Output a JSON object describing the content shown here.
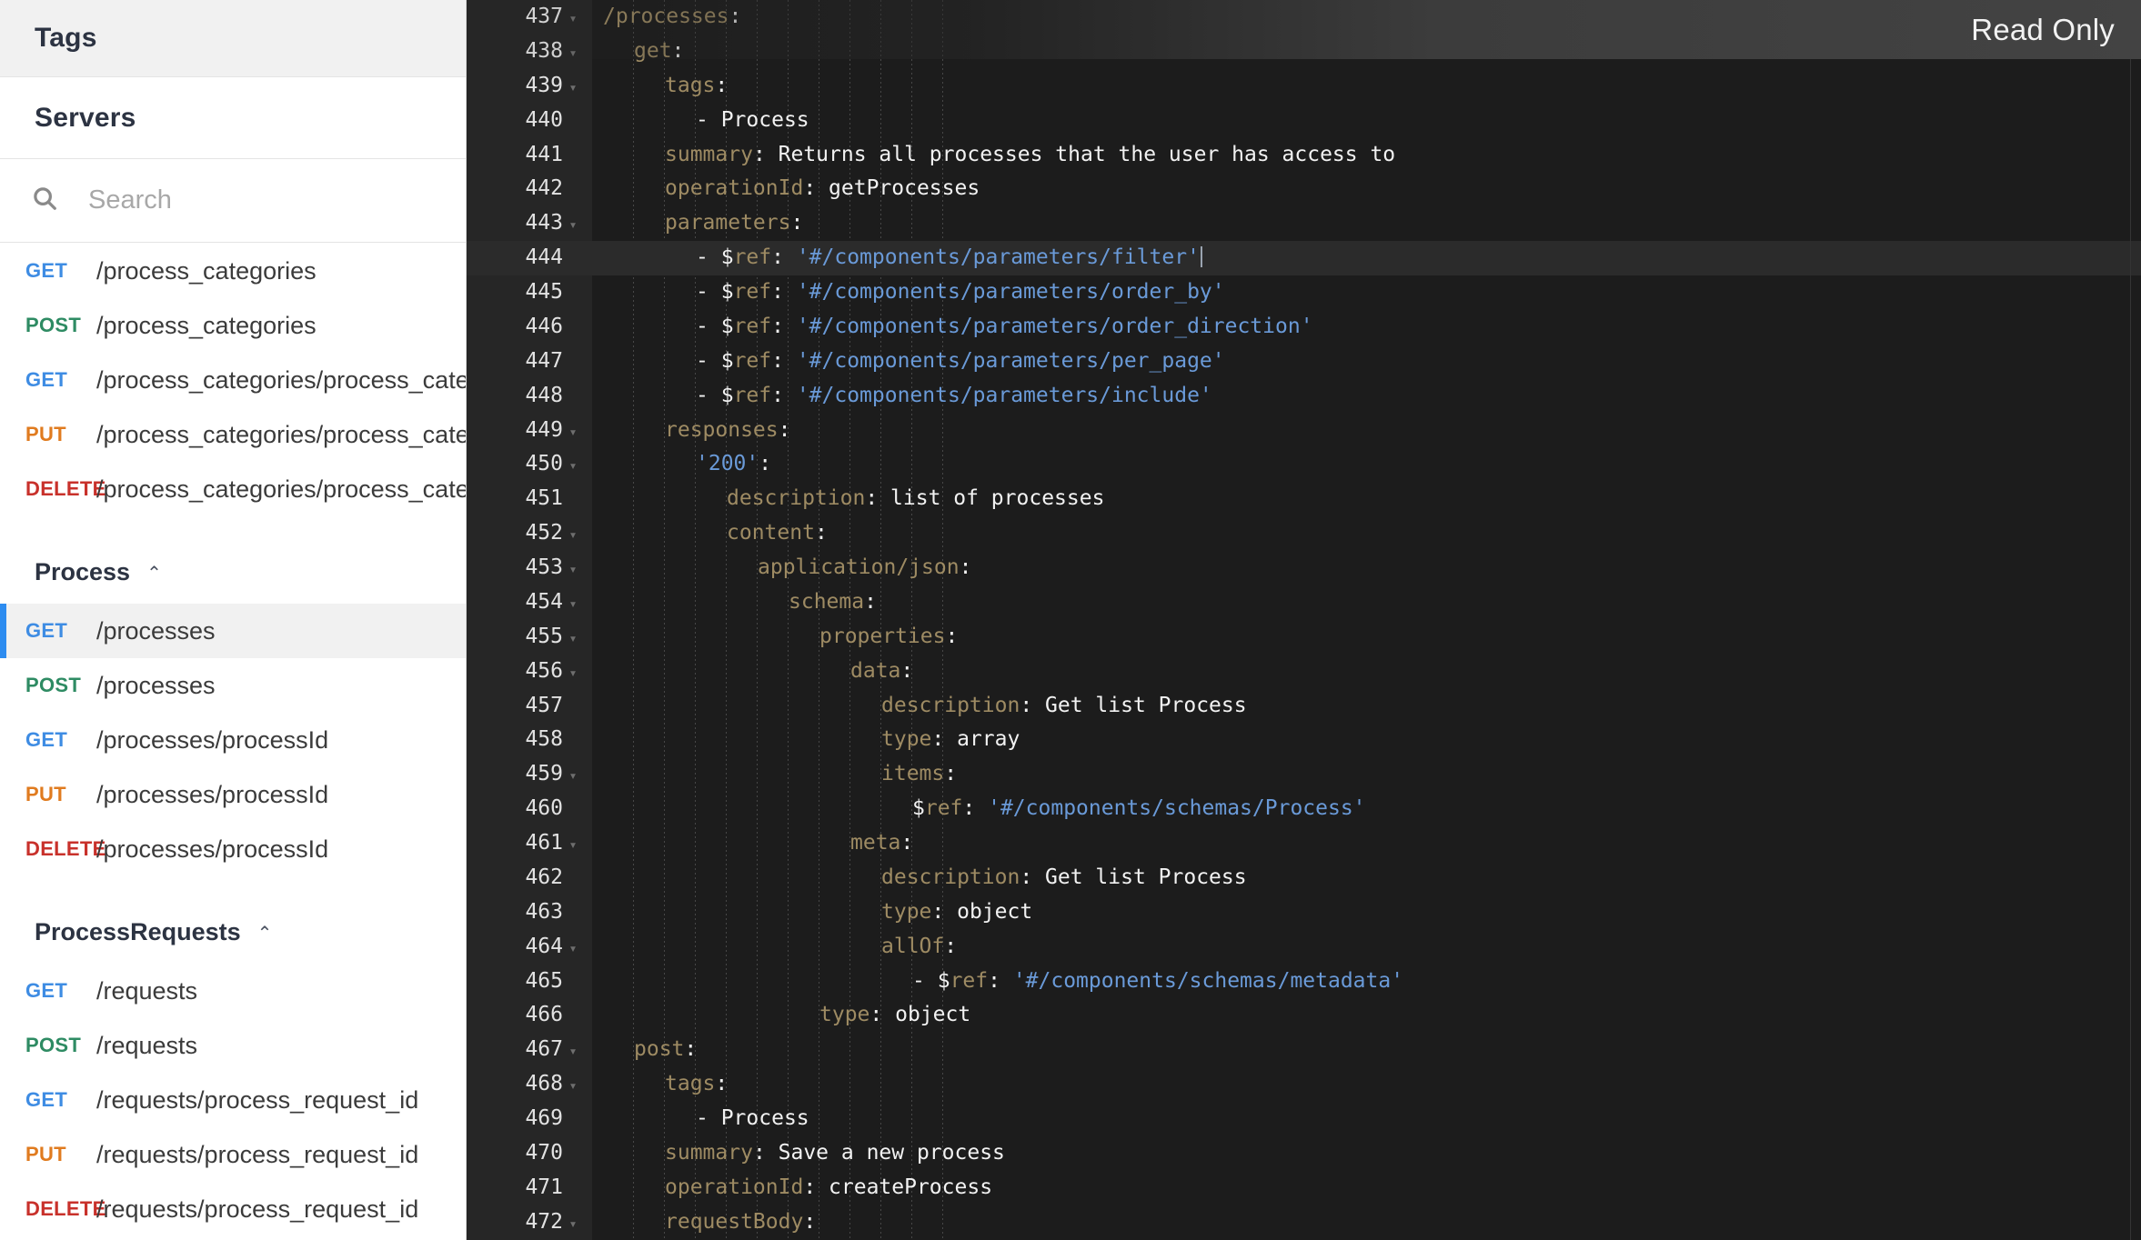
{
  "sidebar": {
    "tags_header": "Tags",
    "servers_header": "Servers",
    "search": {
      "placeholder": "Search",
      "value": "",
      "icon": "search-icon"
    },
    "groups": [
      {
        "name": "",
        "caret": "",
        "operations": [
          {
            "method": "GET",
            "path": "/process_categories",
            "selected": false
          },
          {
            "method": "POST",
            "path": "/process_categories",
            "selected": false
          },
          {
            "method": "GET",
            "path": "/process_categories/process_category_id",
            "selected": false
          },
          {
            "method": "PUT",
            "path": "/process_categories/process_category_id",
            "selected": false
          },
          {
            "method": "DELETE",
            "path": "/process_categories/process_category_id",
            "selected": false
          }
        ]
      },
      {
        "name": "Process",
        "caret": "⌃",
        "operations": [
          {
            "method": "GET",
            "path": "/processes",
            "selected": true
          },
          {
            "method": "POST",
            "path": "/processes",
            "selected": false
          },
          {
            "method": "GET",
            "path": "/processes/processId",
            "selected": false
          },
          {
            "method": "PUT",
            "path": "/processes/processId",
            "selected": false
          },
          {
            "method": "DELETE",
            "path": "/processes/processId",
            "selected": false
          }
        ]
      },
      {
        "name": "ProcessRequests",
        "caret": "⌃",
        "operations": [
          {
            "method": "GET",
            "path": "/requests",
            "selected": false
          },
          {
            "method": "POST",
            "path": "/requests",
            "selected": false
          },
          {
            "method": "GET",
            "path": "/requests/process_request_id",
            "selected": false
          },
          {
            "method": "PUT",
            "path": "/requests/process_request_id",
            "selected": false
          },
          {
            "method": "DELETE",
            "path": "/requests/process_request_id",
            "selected": false
          }
        ]
      }
    ],
    "method_colors": {
      "GET": "#3e8ce3",
      "POST": "#2e8b63",
      "PUT": "#e07b1f",
      "DELETE": "#c8312b"
    }
  },
  "editor": {
    "read_only_label": "Read Only",
    "first_line_number": 437,
    "active_line": 444,
    "caret_line": 444,
    "theme": {
      "background": "#1c1c1c",
      "gutter_background": "#262626",
      "active_line": "#2b2b2b",
      "key_color": "#9e8b63",
      "value_color": "#f2f2f2",
      "string_color": "#6a9ad8",
      "line_number_color": "#e2e2e2"
    },
    "lines": [
      {
        "n": 437,
        "fold": true,
        "indent": 0,
        "tokens": [
          {
            "t": "key",
            "s": "/processes"
          },
          {
            "t": "punc",
            "s": ":"
          }
        ]
      },
      {
        "n": 438,
        "fold": true,
        "indent": 1,
        "tokens": [
          {
            "t": "key",
            "s": "get"
          },
          {
            "t": "punc",
            "s": ":"
          }
        ]
      },
      {
        "n": 439,
        "fold": true,
        "indent": 2,
        "tokens": [
          {
            "t": "key",
            "s": "tags"
          },
          {
            "t": "punc",
            "s": ":"
          }
        ]
      },
      {
        "n": 440,
        "fold": false,
        "indent": 3,
        "tokens": [
          {
            "t": "dash",
            "s": "- "
          },
          {
            "t": "val",
            "s": "Process"
          }
        ]
      },
      {
        "n": 441,
        "fold": false,
        "indent": 2,
        "tokens": [
          {
            "t": "key",
            "s": "summary"
          },
          {
            "t": "punc",
            "s": ": "
          },
          {
            "t": "val",
            "s": "Returns all processes that the user has access to"
          }
        ]
      },
      {
        "n": 442,
        "fold": false,
        "indent": 2,
        "tokens": [
          {
            "t": "key",
            "s": "operationId"
          },
          {
            "t": "punc",
            "s": ": "
          },
          {
            "t": "val",
            "s": "getProcesses"
          }
        ]
      },
      {
        "n": 443,
        "fold": true,
        "indent": 2,
        "tokens": [
          {
            "t": "key",
            "s": "parameters"
          },
          {
            "t": "punc",
            "s": ":"
          }
        ]
      },
      {
        "n": 444,
        "fold": false,
        "indent": 3,
        "tokens": [
          {
            "t": "dash",
            "s": "- "
          },
          {
            "t": "val",
            "s": "$"
          },
          {
            "t": "key",
            "s": "ref"
          },
          {
            "t": "punc",
            "s": ": "
          },
          {
            "t": "str",
            "s": "'#/components/parameters/filter'"
          }
        ]
      },
      {
        "n": 445,
        "fold": false,
        "indent": 3,
        "tokens": [
          {
            "t": "dash",
            "s": "- "
          },
          {
            "t": "val",
            "s": "$"
          },
          {
            "t": "key",
            "s": "ref"
          },
          {
            "t": "punc",
            "s": ": "
          },
          {
            "t": "str",
            "s": "'#/components/parameters/order_by'"
          }
        ]
      },
      {
        "n": 446,
        "fold": false,
        "indent": 3,
        "tokens": [
          {
            "t": "dash",
            "s": "- "
          },
          {
            "t": "val",
            "s": "$"
          },
          {
            "t": "key",
            "s": "ref"
          },
          {
            "t": "punc",
            "s": ": "
          },
          {
            "t": "str",
            "s": "'#/components/parameters/order_direction'"
          }
        ]
      },
      {
        "n": 447,
        "fold": false,
        "indent": 3,
        "tokens": [
          {
            "t": "dash",
            "s": "- "
          },
          {
            "t": "val",
            "s": "$"
          },
          {
            "t": "key",
            "s": "ref"
          },
          {
            "t": "punc",
            "s": ": "
          },
          {
            "t": "str",
            "s": "'#/components/parameters/per_page'"
          }
        ]
      },
      {
        "n": 448,
        "fold": false,
        "indent": 3,
        "tokens": [
          {
            "t": "dash",
            "s": "- "
          },
          {
            "t": "val",
            "s": "$"
          },
          {
            "t": "key",
            "s": "ref"
          },
          {
            "t": "punc",
            "s": ": "
          },
          {
            "t": "str",
            "s": "'#/components/parameters/include'"
          }
        ]
      },
      {
        "n": 449,
        "fold": true,
        "indent": 2,
        "tokens": [
          {
            "t": "key",
            "s": "responses"
          },
          {
            "t": "punc",
            "s": ":"
          }
        ]
      },
      {
        "n": 450,
        "fold": true,
        "indent": 3,
        "tokens": [
          {
            "t": "str",
            "s": "'200'"
          },
          {
            "t": "punc",
            "s": ":"
          }
        ]
      },
      {
        "n": 451,
        "fold": false,
        "indent": 4,
        "tokens": [
          {
            "t": "key",
            "s": "description"
          },
          {
            "t": "punc",
            "s": ": "
          },
          {
            "t": "val",
            "s": "list of processes"
          }
        ]
      },
      {
        "n": 452,
        "fold": true,
        "indent": 4,
        "tokens": [
          {
            "t": "key",
            "s": "content"
          },
          {
            "t": "punc",
            "s": ":"
          }
        ]
      },
      {
        "n": 453,
        "fold": true,
        "indent": 5,
        "tokens": [
          {
            "t": "key",
            "s": "application/json"
          },
          {
            "t": "punc",
            "s": ":"
          }
        ]
      },
      {
        "n": 454,
        "fold": true,
        "indent": 6,
        "tokens": [
          {
            "t": "key",
            "s": "schema"
          },
          {
            "t": "punc",
            "s": ":"
          }
        ]
      },
      {
        "n": 455,
        "fold": true,
        "indent": 7,
        "tokens": [
          {
            "t": "key",
            "s": "properties"
          },
          {
            "t": "punc",
            "s": ":"
          }
        ]
      },
      {
        "n": 456,
        "fold": true,
        "indent": 8,
        "tokens": [
          {
            "t": "key",
            "s": "data"
          },
          {
            "t": "punc",
            "s": ":"
          }
        ]
      },
      {
        "n": 457,
        "fold": false,
        "indent": 9,
        "tokens": [
          {
            "t": "key",
            "s": "description"
          },
          {
            "t": "punc",
            "s": ": "
          },
          {
            "t": "val",
            "s": "Get list Process"
          }
        ]
      },
      {
        "n": 458,
        "fold": false,
        "indent": 9,
        "tokens": [
          {
            "t": "key",
            "s": "type"
          },
          {
            "t": "punc",
            "s": ": "
          },
          {
            "t": "val",
            "s": "array"
          }
        ]
      },
      {
        "n": 459,
        "fold": true,
        "indent": 9,
        "tokens": [
          {
            "t": "key",
            "s": "items"
          },
          {
            "t": "punc",
            "s": ":"
          }
        ]
      },
      {
        "n": 460,
        "fold": false,
        "indent": 10,
        "tokens": [
          {
            "t": "val",
            "s": "$"
          },
          {
            "t": "key",
            "s": "ref"
          },
          {
            "t": "punc",
            "s": ": "
          },
          {
            "t": "str",
            "s": "'#/components/schemas/Process'"
          }
        ]
      },
      {
        "n": 461,
        "fold": true,
        "indent": 8,
        "tokens": [
          {
            "t": "key",
            "s": "meta"
          },
          {
            "t": "punc",
            "s": ":"
          }
        ]
      },
      {
        "n": 462,
        "fold": false,
        "indent": 9,
        "tokens": [
          {
            "t": "key",
            "s": "description"
          },
          {
            "t": "punc",
            "s": ": "
          },
          {
            "t": "val",
            "s": "Get list Process"
          }
        ]
      },
      {
        "n": 463,
        "fold": false,
        "indent": 9,
        "tokens": [
          {
            "t": "key",
            "s": "type"
          },
          {
            "t": "punc",
            "s": ": "
          },
          {
            "t": "val",
            "s": "object"
          }
        ]
      },
      {
        "n": 464,
        "fold": true,
        "indent": 9,
        "tokens": [
          {
            "t": "key",
            "s": "allOf"
          },
          {
            "t": "punc",
            "s": ":"
          }
        ]
      },
      {
        "n": 465,
        "fold": false,
        "indent": 10,
        "tokens": [
          {
            "t": "dash",
            "s": "- "
          },
          {
            "t": "val",
            "s": "$"
          },
          {
            "t": "key",
            "s": "ref"
          },
          {
            "t": "punc",
            "s": ": "
          },
          {
            "t": "str",
            "s": "'#/components/schemas/metadata'"
          }
        ]
      },
      {
        "n": 466,
        "fold": false,
        "indent": 7,
        "tokens": [
          {
            "t": "key",
            "s": "type"
          },
          {
            "t": "punc",
            "s": ": "
          },
          {
            "t": "val",
            "s": "object"
          }
        ]
      },
      {
        "n": 467,
        "fold": true,
        "indent": 1,
        "tokens": [
          {
            "t": "key",
            "s": "post"
          },
          {
            "t": "punc",
            "s": ":"
          }
        ]
      },
      {
        "n": 468,
        "fold": true,
        "indent": 2,
        "tokens": [
          {
            "t": "key",
            "s": "tags"
          },
          {
            "t": "punc",
            "s": ":"
          }
        ]
      },
      {
        "n": 469,
        "fold": false,
        "indent": 3,
        "tokens": [
          {
            "t": "dash",
            "s": "- "
          },
          {
            "t": "val",
            "s": "Process"
          }
        ]
      },
      {
        "n": 470,
        "fold": false,
        "indent": 2,
        "tokens": [
          {
            "t": "key",
            "s": "summary"
          },
          {
            "t": "punc",
            "s": ": "
          },
          {
            "t": "val",
            "s": "Save a new process"
          }
        ]
      },
      {
        "n": 471,
        "fold": false,
        "indent": 2,
        "tokens": [
          {
            "t": "key",
            "s": "operationId"
          },
          {
            "t": "punc",
            "s": ": "
          },
          {
            "t": "val",
            "s": "createProcess"
          }
        ]
      },
      {
        "n": 472,
        "fold": true,
        "indent": 2,
        "tokens": [
          {
            "t": "key",
            "s": "requestBody"
          },
          {
            "t": "punc",
            "s": ":"
          }
        ]
      }
    ]
  }
}
